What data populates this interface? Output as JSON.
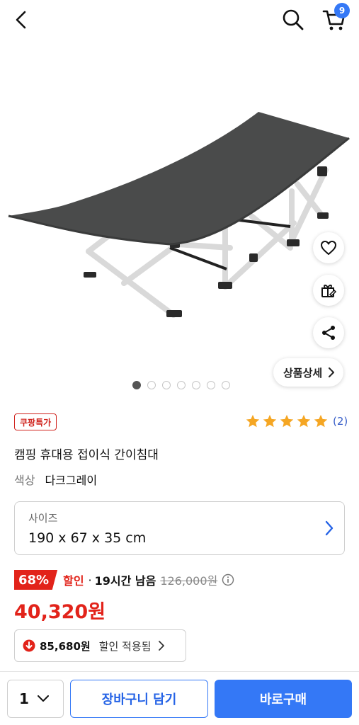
{
  "header": {
    "back_icon": "chevron-left-icon",
    "search_icon": "search-icon",
    "cart_icon": "cart-icon",
    "cart_count": "9"
  },
  "product_image": {
    "image_count": 7,
    "active_index": 0
  },
  "side_actions": [
    {
      "icon": "heart-icon"
    },
    {
      "icon": "gift-icon"
    },
    {
      "icon": "share-icon"
    }
  ],
  "detail_button": {
    "label": "상품상세"
  },
  "badge": {
    "label": "쿠팡특가",
    "color": "#d0231d"
  },
  "rating": {
    "stars": 5,
    "count": "(2)"
  },
  "product": {
    "title": "캠핑 휴대용 접이식 간이침대",
    "color_label": "색상",
    "color_value": "다크그레이"
  },
  "size_option": {
    "label": "사이즈",
    "value": "190 x 67 x 35 cm"
  },
  "pricing": {
    "discount_pct": "68%",
    "discount_word": "할인",
    "separator": "·",
    "remaining": "19시간 남음",
    "original_price": "126,000원",
    "sale_price": "40,320원",
    "coupon_price": "85,680원",
    "coupon_text": "할인 적용됨",
    "accent_color": "#e2231a"
  },
  "bottom_bar": {
    "quantity": "1",
    "add_to_cart": "장바구니 담기",
    "buy_now": "바로구매",
    "brand_color": "#3478f6"
  }
}
